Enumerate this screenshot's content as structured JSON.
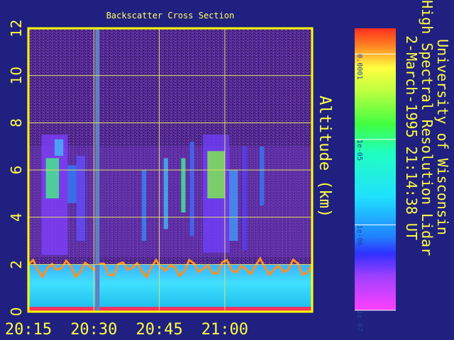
{
  "chart_data": {
    "type": "heatmap",
    "title": "Backscatter Cross Section",
    "ylabel": "Altitude (km)",
    "xlabel": "",
    "x_ticks": [
      "20:15",
      "20:30",
      "20:45",
      "21:00"
    ],
    "y_ticks": [
      0,
      2,
      4,
      6,
      8,
      10,
      12
    ],
    "ylim": [
      0,
      12
    ],
    "xlim": [
      "20:15",
      "21:20"
    ],
    "grid": true,
    "colorbar": {
      "scale": "log",
      "range": [
        1e-07,
        0.0002
      ],
      "tick_labels": [
        "0.0001",
        "1e-05",
        "1e-06",
        "1e-07"
      ],
      "tick_values": [
        0.0001,
        1e-05,
        1e-06,
        1e-07
      ]
    },
    "features": [
      {
        "name": "boundary layer aerosol",
        "altitude_km": [
          0,
          2.0
        ]
      },
      {
        "name": "cirrus / ice cloud streaks",
        "altitude_km": [
          2.5,
          7.5
        ]
      },
      {
        "name": "data gap",
        "time": "20:30"
      }
    ]
  },
  "side_text": {
    "line1": "University of Wisconsin",
    "line2": "High Spectral Resolution Lidar",
    "line3": "2-March-1995 21:14:38 UT"
  },
  "colors": {
    "background": "#202080",
    "axis": "#ffff44",
    "plot_frame": "#ffff00"
  }
}
